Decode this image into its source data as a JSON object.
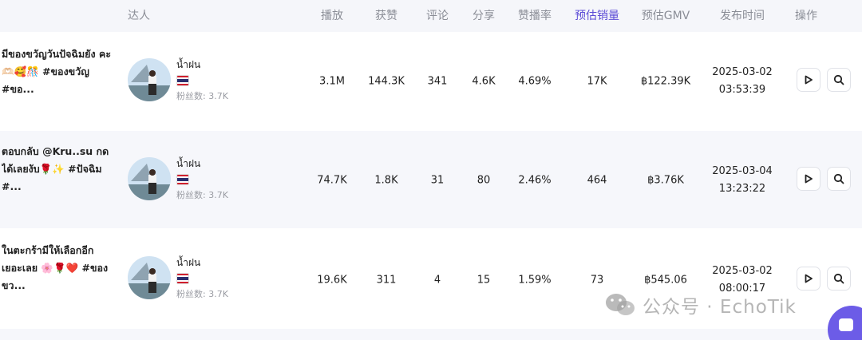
{
  "columns": {
    "creator": "达人",
    "plays": "播放",
    "likes": "获赞",
    "comments": "评论",
    "shares": "分享",
    "like_rate": "赞播率",
    "est_sales": "预估销量",
    "est_gmv": "预估GMV",
    "publish_time": "发布时间",
    "actions": "操作"
  },
  "active_column": "est_sales",
  "accent_color": "#5b4bd6",
  "rows": [
    {
      "title": "มีของขวัญวันปัจฉิมยัง คะ🫶🏻🥰🎊 #ของขวัญ #ขอ...",
      "creator_name": "น้ำฝน",
      "flag": "thailand-flag",
      "fans": "粉丝数: 3.7K",
      "plays": "3.1M",
      "likes": "144.3K",
      "comments": "341",
      "shares": "4.6K",
      "like_rate": "4.69%",
      "est_sales": "17K",
      "est_gmv": "฿122.39K",
      "publish_time": "2025-03-02\n03:53:39"
    },
    {
      "title": "ตอบกลับ @Kru..su กดได้เลยงับ🌹✨ #ปัจฉิม #...",
      "creator_name": "น้ำฝน",
      "flag": "thailand-flag",
      "fans": "粉丝数: 3.7K",
      "plays": "74.7K",
      "likes": "1.8K",
      "comments": "31",
      "shares": "80",
      "like_rate": "2.46%",
      "est_sales": "464",
      "est_gmv": "฿3.76K",
      "publish_time": "2025-03-04\n13:23:22"
    },
    {
      "title": "ในตะกร้ามีให้เลือกอีก เยอะเลย 🌸🌹❤️ #ของขว...",
      "creator_name": "น้ำฝน",
      "flag": "thailand-flag",
      "fans": "粉丝数: 3.7K",
      "plays": "19.6K",
      "likes": "311",
      "comments": "4",
      "shares": "15",
      "like_rate": "1.59%",
      "est_sales": "73",
      "est_gmv": "฿545.06",
      "publish_time": "2025-03-02\n08:00:17"
    }
  ],
  "watermark": "公众号 · EchoTik",
  "icons": {
    "play": "play-icon",
    "search": "search-icon",
    "wechat": "wechat-icon",
    "chat": "chat-icon"
  }
}
